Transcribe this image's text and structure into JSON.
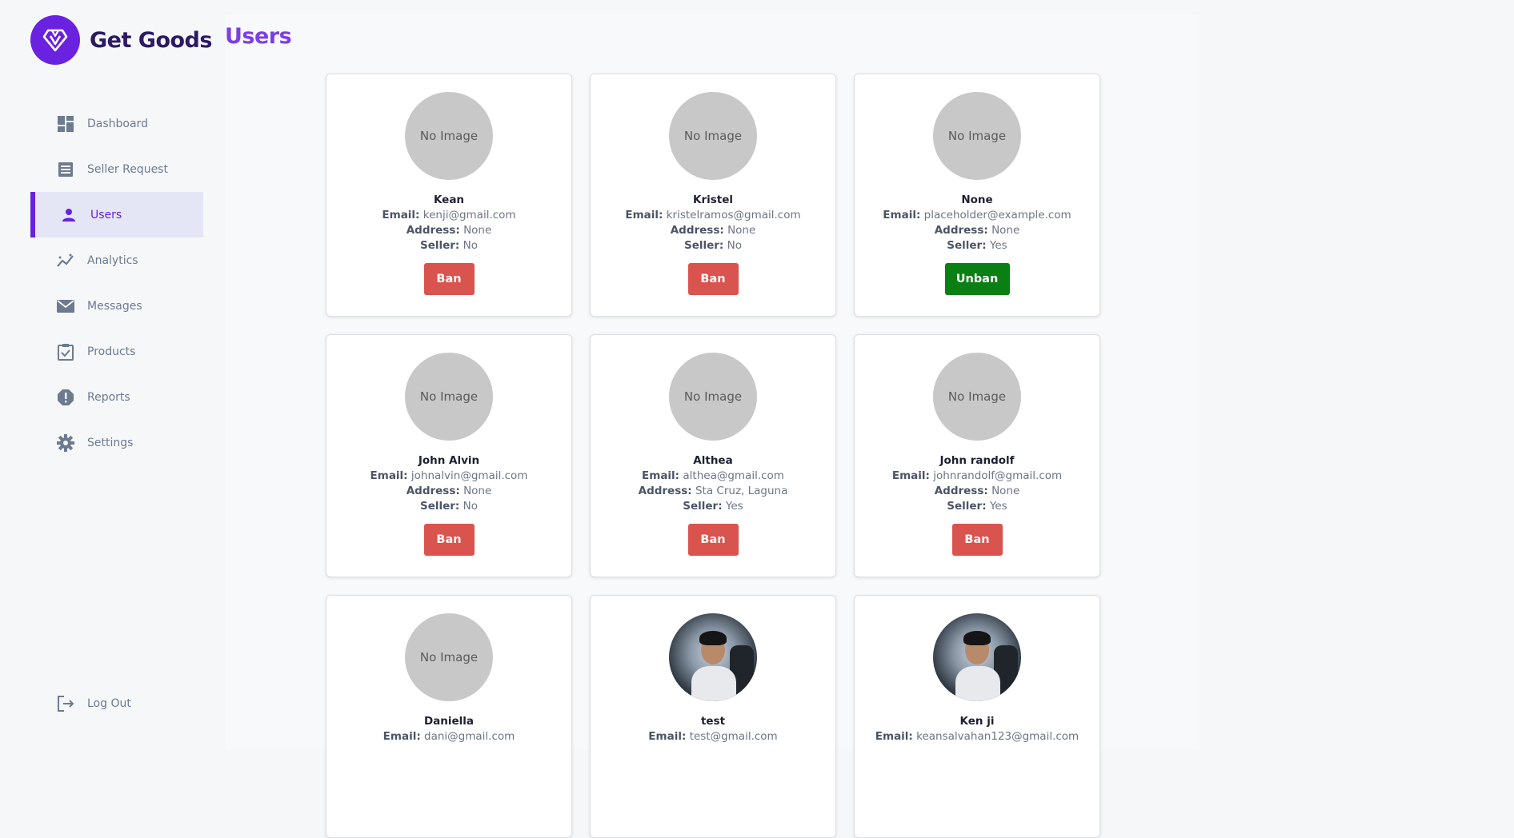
{
  "app": {
    "name": "Get Goods"
  },
  "sidebar": {
    "items": [
      {
        "label": "Dashboard",
        "icon": "dashboard-icon",
        "active": false
      },
      {
        "label": "Seller Request",
        "icon": "list-icon",
        "active": false
      },
      {
        "label": "Users",
        "icon": "user-icon",
        "active": true
      },
      {
        "label": "Analytics",
        "icon": "analytics-icon",
        "active": false
      },
      {
        "label": "Messages",
        "icon": "mail-icon",
        "active": false
      },
      {
        "label": "Products",
        "icon": "clipboard-check-icon",
        "active": false
      },
      {
        "label": "Reports",
        "icon": "alert-icon",
        "active": false
      },
      {
        "label": "Settings",
        "icon": "gear-icon",
        "active": false
      }
    ],
    "logout_label": "Log Out"
  },
  "page": {
    "title": "Users"
  },
  "labels": {
    "email": "Email:",
    "address": "Address:",
    "seller": "Seller:",
    "no_image": "No Image"
  },
  "users": [
    {
      "name": "Kean",
      "email": "kenji@gmail.com",
      "address": "None",
      "seller": "No",
      "action": "Ban",
      "photo": false
    },
    {
      "name": "Kristel",
      "email": "kristelramos@gmail.com",
      "address": "None",
      "seller": "No",
      "action": "Ban",
      "photo": false
    },
    {
      "name": "None",
      "email": "placeholder@example.com",
      "address": "None",
      "seller": "Yes",
      "action": "Unban",
      "photo": false
    },
    {
      "name": "John Alvin",
      "email": "johnalvin@gmail.com",
      "address": "None",
      "seller": "No",
      "action": "Ban",
      "photo": false
    },
    {
      "name": "Althea",
      "email": "althea@gmail.com",
      "address": "Sta Cruz, Laguna",
      "seller": "Yes",
      "action": "Ban",
      "photo": false
    },
    {
      "name": "John randolf",
      "email": "johnrandolf@gmail.com",
      "address": "None",
      "seller": "Yes",
      "action": "Ban",
      "photo": false
    },
    {
      "name": "Daniella",
      "email": "dani@gmail.com",
      "address": "",
      "seller": "",
      "action": "",
      "photo": false
    },
    {
      "name": "test",
      "email": "test@gmail.com",
      "address": "",
      "seller": "",
      "action": "",
      "photo": true
    },
    {
      "name": "Ken ji",
      "email": "keansalvahan123@gmail.com",
      "address": "",
      "seller": "",
      "action": "",
      "photo": true
    }
  ],
  "colors": {
    "brand": "#6a22e0",
    "active": "#6622dd",
    "title": "#7b3fe4",
    "ban": "#d9534f",
    "unban": "#0a7f14"
  }
}
